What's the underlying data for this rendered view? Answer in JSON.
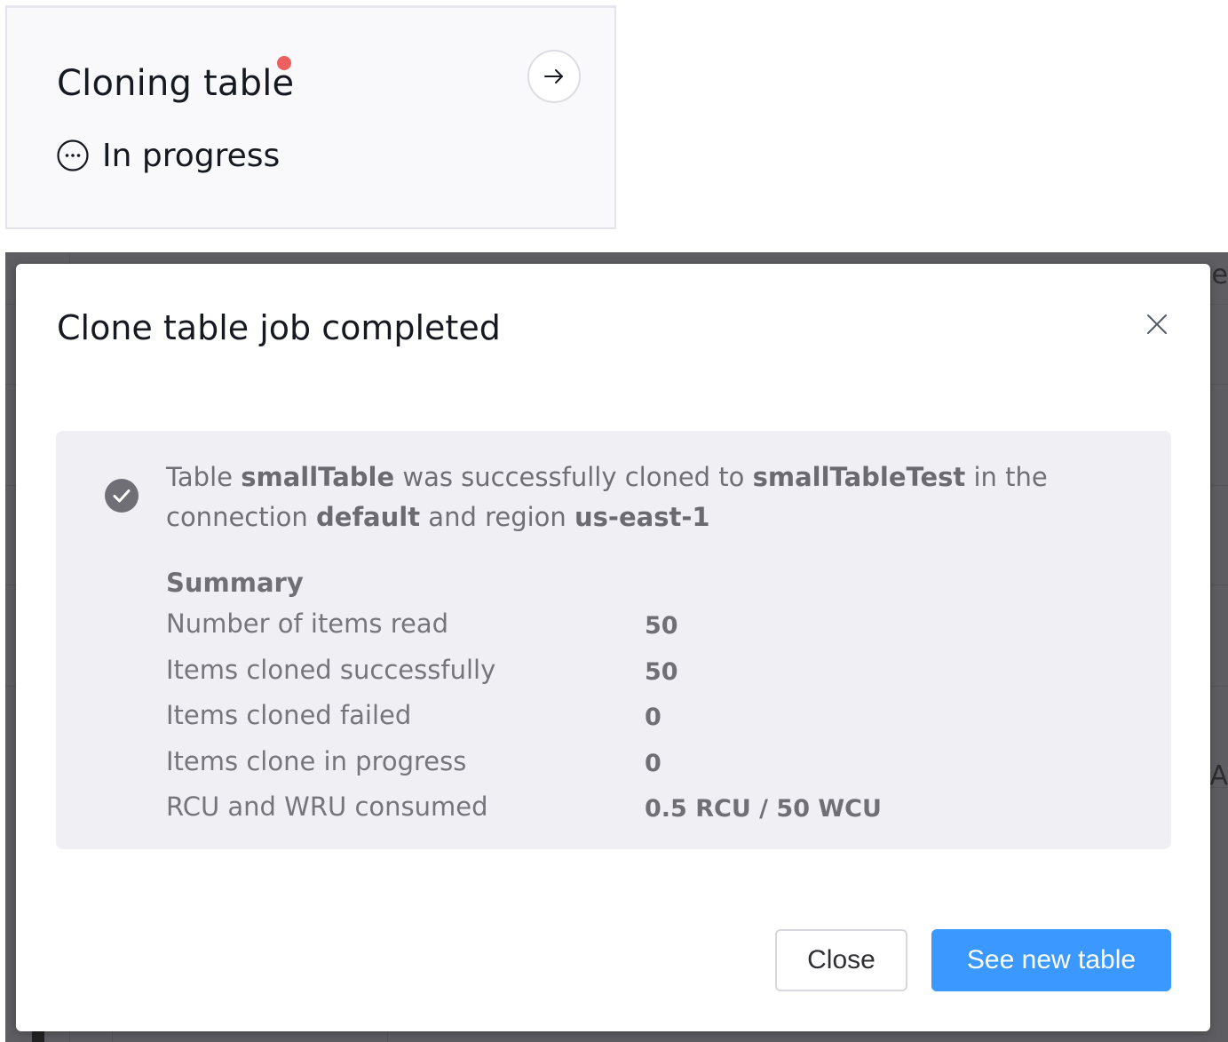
{
  "notification": {
    "title": "Cloning table",
    "status": "In progress",
    "dot_color": "#ee5f60",
    "icons": {
      "status": "ellipsis-circle-icon",
      "open": "arrow-right-icon"
    }
  },
  "modal": {
    "title": "Clone table job completed",
    "close_icon": "close-x-icon",
    "message": {
      "icon": "check-circle-icon",
      "p1": "Table ",
      "source_table": "smallTable",
      "p2": " was successfully cloned to ",
      "target_table": "smallTableTest",
      "p3": " in the connection ",
      "connection": "default",
      "p4": " and region ",
      "region": "us-east-1"
    },
    "summary": {
      "title": "Summary",
      "rows": [
        {
          "label": "Number of items read",
          "value": "50"
        },
        {
          "label": "Items cloned successfully",
          "value": "50"
        },
        {
          "label": "Items cloned failed",
          "value": "0"
        },
        {
          "label": "Items clone in progress",
          "value": "0"
        },
        {
          "label": "RCU and WRU consumed",
          "value": "0.5 RCU / 50 WCU"
        }
      ]
    },
    "buttons": {
      "close": "Close",
      "primary": "See new table"
    },
    "primary_color": "#3a98ff"
  }
}
